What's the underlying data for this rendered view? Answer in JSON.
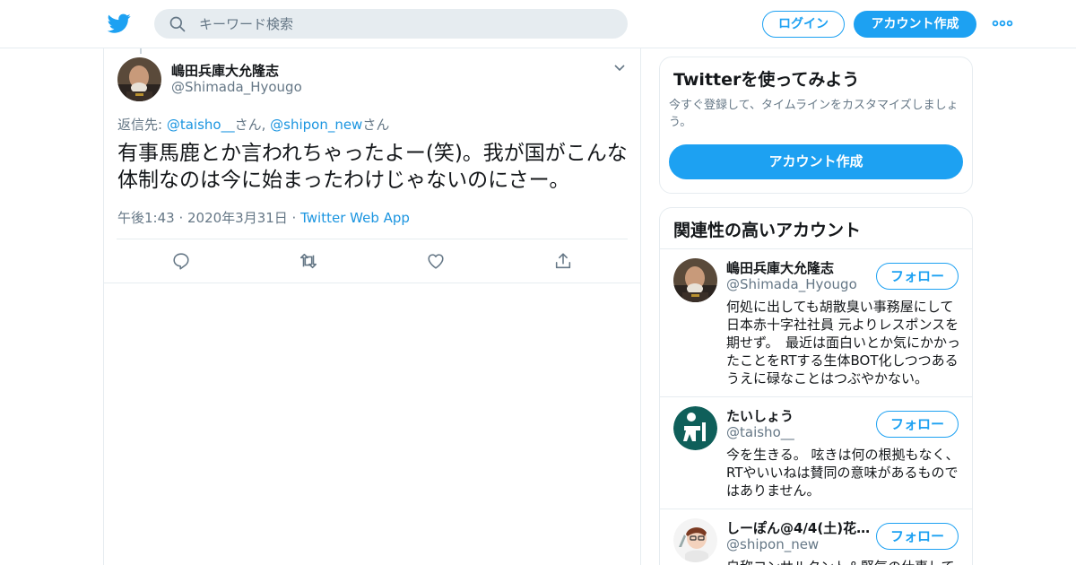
{
  "header": {
    "search_placeholder": "キーワード検索",
    "login_label": "ログイン",
    "signup_label": "アカウント作成",
    "logo_icon": "twitter-bird-icon",
    "more_icon": "more-dots-icon"
  },
  "tweet": {
    "name": "嶋田兵庫大允隆志",
    "handle": "@Shimada_Hyougo",
    "reply_prefix": "返信先: ",
    "reply_user1": "@taisho__",
    "reply_suffix1": "さん, ",
    "reply_user2": "@shipon_new",
    "reply_suffix2": "さん",
    "text": "有事馬鹿とか言われちゃったよー(笑)。我が国がこんな体制なのは今に始まったわけじゃないのにさー。",
    "timestamp": "午後1:43 · 2020年3月31日 · ",
    "source": "Twitter Web App",
    "actions": [
      "reply-icon",
      "retweet-icon",
      "like-icon",
      "share-icon"
    ]
  },
  "signup_card": {
    "title": "Twitterを使ってみよう",
    "desc": "今すぐ登録して、タイムラインをカスタマイズしましょう。",
    "button": "アカウント作成"
  },
  "related": {
    "title": "関連性の高いアカウント",
    "follow_label": "フォロー",
    "accounts": [
      {
        "name": "嶋田兵庫大允隆志",
        "handle": "@Shimada_Hyougo",
        "bio": "何処に出しても胡散臭い事務屋にして日本赤十字社社員 元よりレスポンスを期せず。　最近は面白いとか気にかかったことをRTする生体BOT化しつつあるうえに碌なことはつぶやかない。"
      },
      {
        "name": "たいしょう",
        "handle": "@taisho__",
        "bio": "今を生きる。 呟きは何の根拠もなく、RTやいいねは賛同の意味があるものではありません。"
      },
      {
        "name": "しーぽん@4/4(土)花…",
        "handle": "@shipon_new",
        "bio": "自称コンサルタント＆堅気の仕事して"
      }
    ]
  },
  "colors": {
    "brand": "#1da1f2",
    "link": "#1b95e0",
    "muted": "#657786",
    "border": "#e6ecf0"
  }
}
